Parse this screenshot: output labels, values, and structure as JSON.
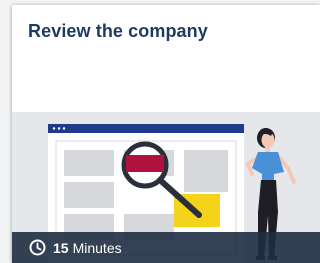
{
  "card": {
    "title": "Review the company",
    "illustration": "review-company-illustration",
    "duration": {
      "icon": "clock-icon",
      "value": "15",
      "unit": "Minutes"
    }
  },
  "colors": {
    "title": "#1f3a5f",
    "footer_bg": "#1f2d42",
    "browser_bar": "#1f3b8c",
    "highlight_red": "#b0123f",
    "highlight_yellow": "#f5d31a",
    "shirt_blue": "#4a90d9"
  }
}
